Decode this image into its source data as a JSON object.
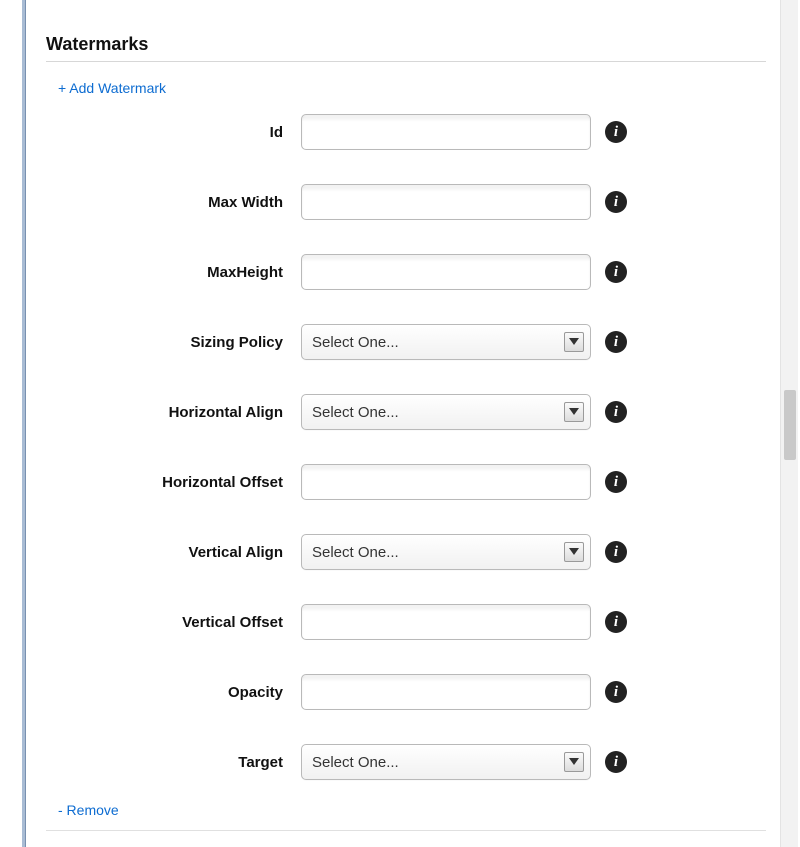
{
  "section": {
    "title": "Watermarks",
    "add_link": "+ Add Watermark",
    "remove_link": "- Remove"
  },
  "select_placeholder": "Select One...",
  "fields": {
    "id": {
      "label": "Id",
      "type": "text",
      "value": ""
    },
    "max_width": {
      "label": "Max Width",
      "type": "text",
      "value": ""
    },
    "max_height": {
      "label": "MaxHeight",
      "type": "text",
      "value": ""
    },
    "sizing_policy": {
      "label": "Sizing Policy",
      "type": "select",
      "value": "Select One..."
    },
    "horizontal_align": {
      "label": "Horizontal Align",
      "type": "select",
      "value": "Select One..."
    },
    "horizontal_offset": {
      "label": "Horizontal Offset",
      "type": "text",
      "value": ""
    },
    "vertical_align": {
      "label": "Vertical Align",
      "type": "select",
      "value": "Select One..."
    },
    "vertical_offset": {
      "label": "Vertical Offset",
      "type": "text",
      "value": ""
    },
    "opacity": {
      "label": "Opacity",
      "type": "text",
      "value": ""
    },
    "target": {
      "label": "Target",
      "type": "select",
      "value": "Select One..."
    }
  }
}
